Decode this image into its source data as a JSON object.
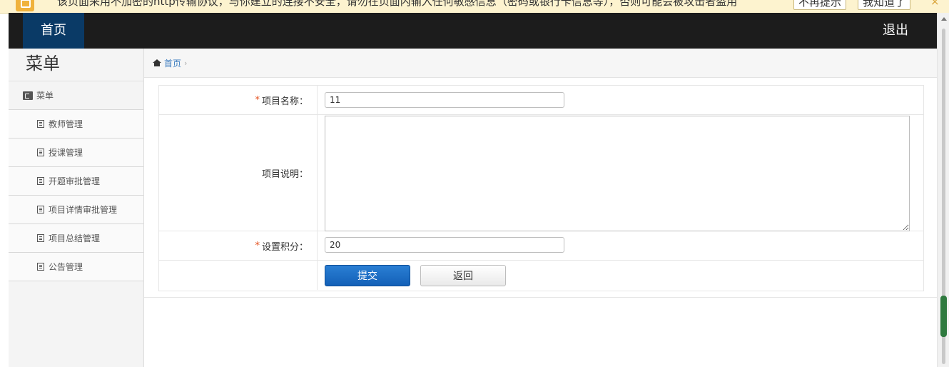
{
  "warning": {
    "text": "该页面采用不加密的http传输协议，与你建立的连接不安全，请勿在页面内输入任何敏感信息（密码或银行卡信息等），否则可能会被攻击者盗用",
    "btn_no_remind": "不再提示",
    "btn_got_it": "我知道了",
    "close": "×"
  },
  "navbar": {
    "home": "首页",
    "logout": "退出"
  },
  "sidebar": {
    "title": "菜单",
    "section": "菜单",
    "items": [
      {
        "label": "教师管理"
      },
      {
        "label": "授课管理"
      },
      {
        "label": "开题审批管理"
      },
      {
        "label": "项目详情审批管理"
      },
      {
        "label": "项目总结管理"
      },
      {
        "label": "公告管理"
      }
    ]
  },
  "breadcrumb": {
    "home": "首页",
    "sep": "›"
  },
  "form": {
    "required_mark": "*",
    "name_label": "项目名称：",
    "name_value": "11",
    "desc_label": "项目说明：",
    "desc_value": "",
    "score_label": "设置积分：",
    "score_value": "20",
    "submit": "提交",
    "back": "返回"
  },
  "colors": {
    "navbar_bg": "#1c1c1c",
    "home_tab_bg": "#0a3a66",
    "submit_bg": "#1f6fc6",
    "warning_bg": "#fdf3cf",
    "scroll_thumb": "#2f7a3f"
  }
}
